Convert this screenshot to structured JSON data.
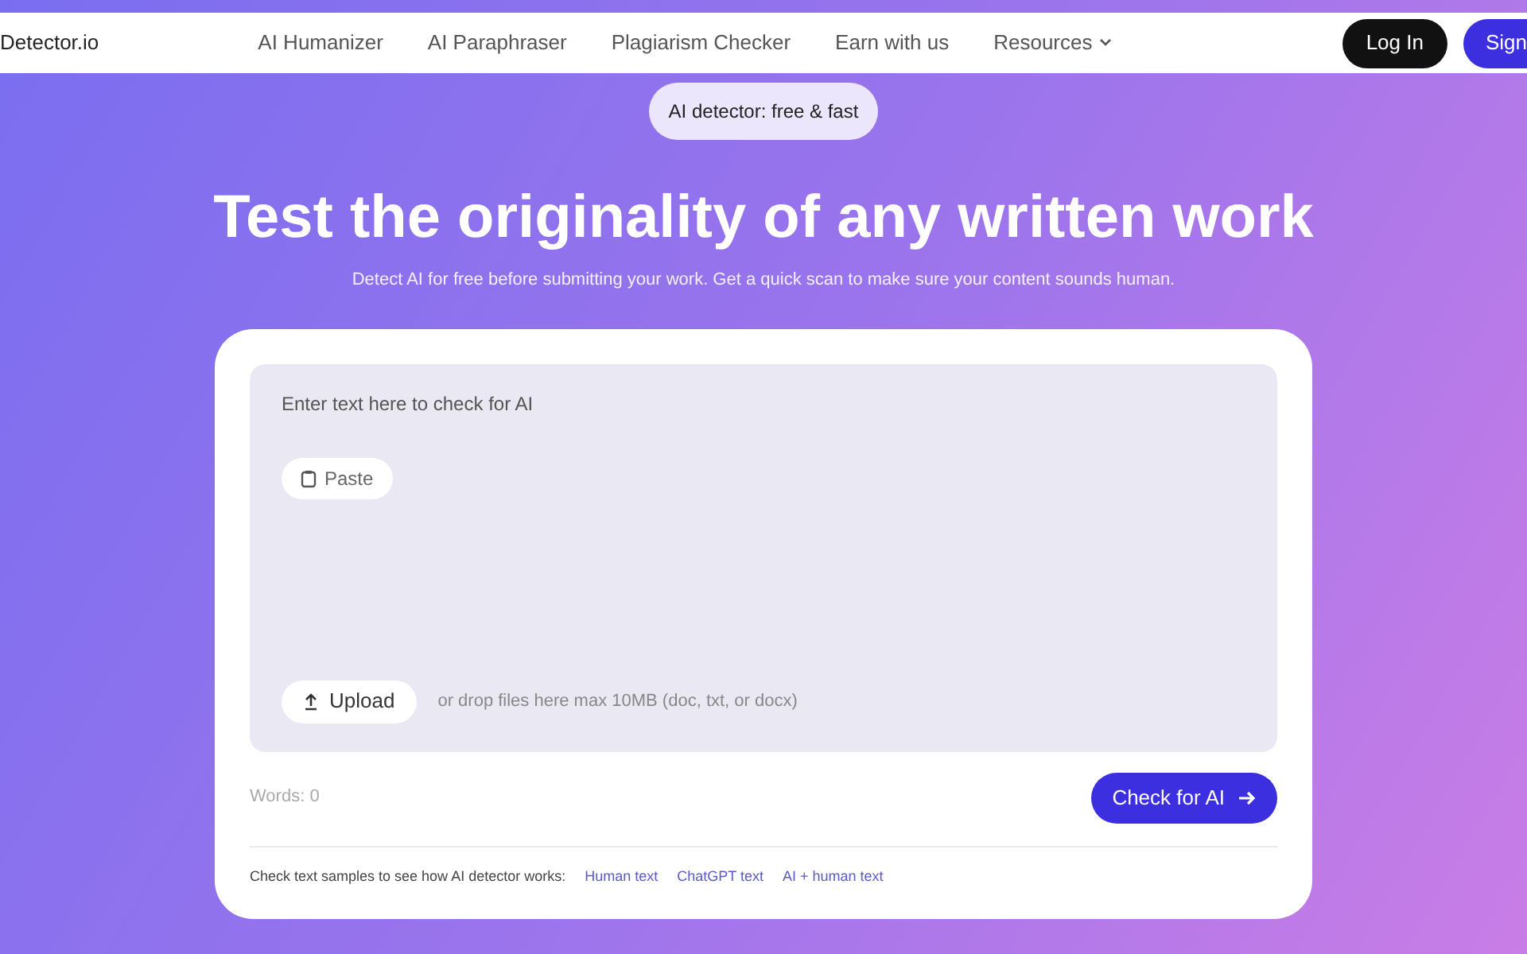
{
  "nav": {
    "logo": "Detector.io",
    "links": [
      {
        "label": "AI Humanizer",
        "kind": "link"
      },
      {
        "label": "AI Paraphraser",
        "kind": "link"
      },
      {
        "label": "Plagiarism Checker",
        "kind": "link"
      },
      {
        "label": "Earn with us",
        "kind": "link"
      },
      {
        "label": "Resources",
        "kind": "dropdown"
      }
    ],
    "login": "Log In",
    "signup": "Sign"
  },
  "badge": "AI detector: free & fast",
  "title": "Test the originality of any written work",
  "subtitle": "Detect AI for free before submitting your work. Get a quick scan to make sure your content sounds human.",
  "editor": {
    "placeholder": "Enter text here to check for AI",
    "paste": "Paste",
    "upload": "Upload",
    "drop_hint": "or drop files here max 10MB (doc, txt, or docx)"
  },
  "words": "Words: 0",
  "check_button": "Check for AI",
  "samples": {
    "label": "Check text samples to see how AI detector works:",
    "links": [
      "Human text",
      "ChatGPT text",
      "AI + human text"
    ]
  }
}
